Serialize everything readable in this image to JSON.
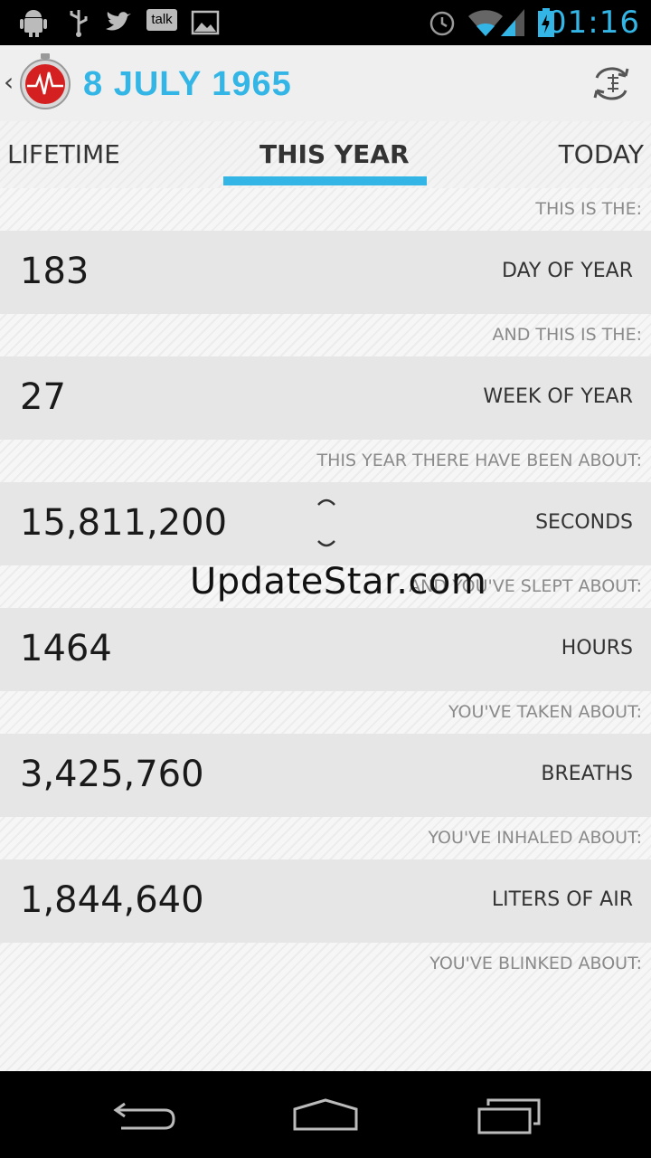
{
  "status_bar": {
    "time": "01:16",
    "left_icons": [
      "android-debug-icon",
      "usb-icon",
      "twitter-icon",
      "talk-icon",
      "gallery-icon"
    ],
    "talk_label": "talk",
    "right_icons": [
      "alarm-icon",
      "wifi-icon",
      "signal-icon",
      "battery-charging-icon"
    ]
  },
  "action_bar": {
    "title": "8 JULY 1965",
    "back_glyph": "‹",
    "accent": "#33b5e5"
  },
  "tabs": [
    {
      "label": "LIFETIME",
      "selected": false
    },
    {
      "label": "THIS YEAR",
      "selected": true
    },
    {
      "label": "TODAY",
      "selected": false
    }
  ],
  "stats": [
    {
      "label": "THIS IS THE:",
      "value": "183",
      "unit": "DAY OF YEAR"
    },
    {
      "label": "AND THIS IS THE:",
      "value": "27",
      "unit": "WEEK OF YEAR"
    },
    {
      "label": "THIS YEAR THERE HAVE BEEN ABOUT:",
      "value": "15,811,200",
      "unit": "SECONDS"
    },
    {
      "label": "AND YOU'VE SLEPT ABOUT:",
      "value": "1464",
      "unit": "HOURS"
    },
    {
      "label": "YOU'VE TAKEN ABOUT:",
      "value": "3,425,760",
      "unit": "BREATHS"
    },
    {
      "label": "YOU'VE INHALED ABOUT:",
      "value": "1,844,640",
      "unit": "LITERS OF AIR"
    }
  ],
  "trailing_label": "YOU'VE BLINKED ABOUT:",
  "watermark": "UpdateStar.com",
  "nav_bar": {
    "icons": [
      "back-icon",
      "home-icon",
      "recent-apps-icon"
    ]
  }
}
